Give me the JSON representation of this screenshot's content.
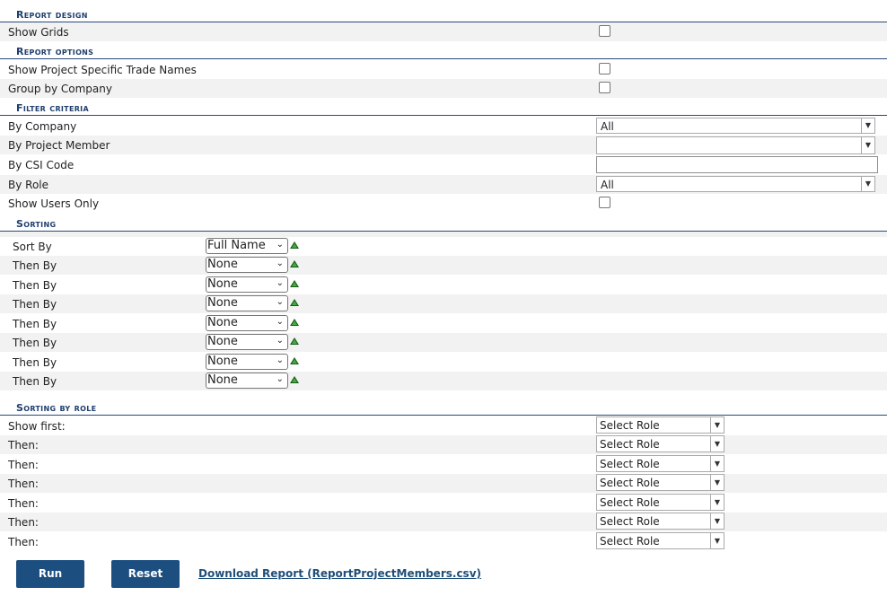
{
  "sections": {
    "report_design": "Report design",
    "report_options": "Report options",
    "filter_criteria": "Filter criteria",
    "sorting": "Sorting",
    "sorting_by_role": "Sorting by role"
  },
  "report_design": {
    "show_grids_label": "Show Grids"
  },
  "report_options": {
    "trade_names_label": "Show Project Specific Trade Names",
    "group_by_company_label": "Group by Company"
  },
  "filter": {
    "by_company_label": "By Company",
    "by_company_value": "All",
    "by_project_member_label": "By Project Member",
    "by_project_member_value": "",
    "by_csi_code_label": "By CSI Code",
    "by_csi_code_value": "",
    "by_role_label": "By Role",
    "by_role_value": "All",
    "show_users_only_label": "Show Users Only"
  },
  "sorting": [
    {
      "label": "Sort By",
      "value": "Full Name"
    },
    {
      "label": "Then By",
      "value": "None"
    },
    {
      "label": "Then By",
      "value": "None"
    },
    {
      "label": "Then By",
      "value": "None"
    },
    {
      "label": "Then By",
      "value": "None"
    },
    {
      "label": "Then By",
      "value": "None"
    },
    {
      "label": "Then By",
      "value": "None"
    },
    {
      "label": "Then By",
      "value": "None"
    }
  ],
  "role_sorting": [
    {
      "label": "Show first:",
      "value": "Select Role"
    },
    {
      "label": "Then:",
      "value": "Select Role"
    },
    {
      "label": "Then:",
      "value": "Select Role"
    },
    {
      "label": "Then:",
      "value": "Select Role"
    },
    {
      "label": "Then:",
      "value": "Select Role"
    },
    {
      "label": "Then:",
      "value": "Select Role"
    },
    {
      "label": "Then:",
      "value": "Select Role"
    }
  ],
  "actions": {
    "run_label": "Run",
    "reset_label": "Reset",
    "download_label": "Download Report (ReportProjectMembers.csv)"
  },
  "colors": {
    "accent": "#1c4e80",
    "section_text": "#1f3e6e",
    "alt_row": "#f2f2f2"
  }
}
